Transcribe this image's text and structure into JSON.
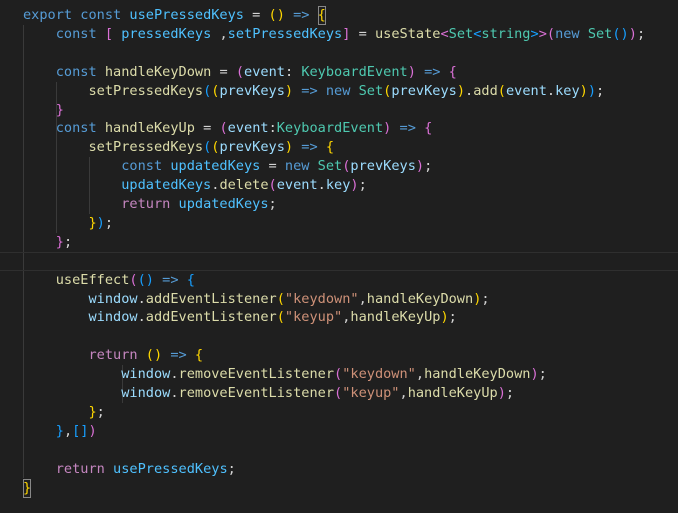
{
  "editor": {
    "language": "typescript",
    "theme_colors": {
      "background": "#1f1f1f",
      "keyword": "#569cd6",
      "control": "#c586c0",
      "constant": "#4fc1ff",
      "identifier": "#9cdcfe",
      "function": "#dcdcaa",
      "type": "#4ec9b0",
      "string": "#ce9178",
      "bracket_1": "#ffd700",
      "bracket_2": "#da70d6",
      "bracket_3": "#179fff"
    },
    "lines": [
      [
        [
          "t-kw",
          "export"
        ],
        [
          "t-op",
          " "
        ],
        [
          "t-kw",
          "const"
        ],
        [
          "t-op",
          " "
        ],
        [
          "t-var",
          "usePressedKeys"
        ],
        [
          "t-op",
          " = "
        ],
        [
          "b1",
          "()"
        ],
        [
          "t-op",
          " "
        ],
        [
          "t-arrow",
          "=>"
        ],
        [
          "t-op",
          " "
        ],
        [
          "b1 bracket-box",
          "{"
        ]
      ],
      [
        [
          "t-op",
          "    "
        ],
        [
          "t-kw",
          "const"
        ],
        [
          "t-op",
          " "
        ],
        [
          "b2",
          "["
        ],
        [
          "t-op",
          " "
        ],
        [
          "t-var",
          "pressedKeys"
        ],
        [
          "t-op",
          " ,"
        ],
        [
          "t-var",
          "setPressedKeys"
        ],
        [
          "b2",
          "]"
        ],
        [
          "t-op",
          " = "
        ],
        [
          "t-fn",
          "useState"
        ],
        [
          "b2",
          "<"
        ],
        [
          "t-type",
          "Set"
        ],
        [
          "b3",
          "<"
        ],
        [
          "t-type",
          "string"
        ],
        [
          "b3",
          ">"
        ],
        [
          "b2",
          ">"
        ],
        [
          "b2",
          "("
        ],
        [
          "t-kw",
          "new"
        ],
        [
          "t-op",
          " "
        ],
        [
          "t-type",
          "Set"
        ],
        [
          "b3",
          "()"
        ],
        [
          "b2",
          ")"
        ],
        [
          "t-op",
          ";"
        ]
      ],
      [],
      [
        [
          "t-op",
          "    "
        ],
        [
          "t-kw",
          "const"
        ],
        [
          "t-op",
          " "
        ],
        [
          "t-fn",
          "handleKeyDown"
        ],
        [
          "t-op",
          " = "
        ],
        [
          "b2",
          "("
        ],
        [
          "t-id",
          "event"
        ],
        [
          "t-op",
          ": "
        ],
        [
          "t-type",
          "KeyboardEvent"
        ],
        [
          "b2",
          ")"
        ],
        [
          "t-op",
          " "
        ],
        [
          "t-arrow",
          "=>"
        ],
        [
          "t-op",
          " "
        ],
        [
          "b2",
          "{"
        ]
      ],
      [
        [
          "t-op",
          "        "
        ],
        [
          "t-fn",
          "setPressedKeys"
        ],
        [
          "b3",
          "("
        ],
        [
          "b1",
          "("
        ],
        [
          "t-id",
          "prevKeys"
        ],
        [
          "b1",
          ")"
        ],
        [
          "t-op",
          " "
        ],
        [
          "t-arrow",
          "=>"
        ],
        [
          "t-op",
          " "
        ],
        [
          "t-kw",
          "new"
        ],
        [
          "t-op",
          " "
        ],
        [
          "t-type",
          "Set"
        ],
        [
          "b1",
          "("
        ],
        [
          "t-id",
          "prevKeys"
        ],
        [
          "b1",
          ")"
        ],
        [
          "t-op",
          "."
        ],
        [
          "t-fn",
          "add"
        ],
        [
          "b1",
          "("
        ],
        [
          "t-id",
          "event"
        ],
        [
          "t-op",
          "."
        ],
        [
          "t-id",
          "key"
        ],
        [
          "b1",
          ")"
        ],
        [
          "b3",
          ")"
        ],
        [
          "t-op",
          ";"
        ]
      ],
      [
        [
          "t-op",
          "    "
        ],
        [
          "b2",
          "}"
        ]
      ],
      [
        [
          "t-op",
          "    "
        ],
        [
          "t-kw",
          "const"
        ],
        [
          "t-op",
          " "
        ],
        [
          "t-fn",
          "handleKeyUp"
        ],
        [
          "t-op",
          " = "
        ],
        [
          "b2",
          "("
        ],
        [
          "t-id",
          "event"
        ],
        [
          "t-op",
          ":"
        ],
        [
          "t-type",
          "KeyboardEvent"
        ],
        [
          "b2",
          ")"
        ],
        [
          "t-op",
          " "
        ],
        [
          "t-arrow",
          "=>"
        ],
        [
          "t-op",
          " "
        ],
        [
          "b2",
          "{"
        ]
      ],
      [
        [
          "t-op",
          "        "
        ],
        [
          "t-fn",
          "setPressedKeys"
        ],
        [
          "b3",
          "("
        ],
        [
          "b1",
          "("
        ],
        [
          "t-id",
          "prevKeys"
        ],
        [
          "b1",
          ")"
        ],
        [
          "t-op",
          " "
        ],
        [
          "t-arrow",
          "=>"
        ],
        [
          "t-op",
          " "
        ],
        [
          "b1",
          "{"
        ]
      ],
      [
        [
          "t-op",
          "            "
        ],
        [
          "t-kw",
          "const"
        ],
        [
          "t-op",
          " "
        ],
        [
          "t-var",
          "updatedKeys"
        ],
        [
          "t-op",
          " = "
        ],
        [
          "t-kw",
          "new"
        ],
        [
          "t-op",
          " "
        ],
        [
          "t-type",
          "Set"
        ],
        [
          "b2",
          "("
        ],
        [
          "t-id",
          "prevKeys"
        ],
        [
          "b2",
          ")"
        ],
        [
          "t-op",
          ";"
        ]
      ],
      [
        [
          "t-op",
          "            "
        ],
        [
          "t-var",
          "updatedKeys"
        ],
        [
          "t-op",
          "."
        ],
        [
          "t-fn",
          "delete"
        ],
        [
          "b2",
          "("
        ],
        [
          "t-id",
          "event"
        ],
        [
          "t-op",
          "."
        ],
        [
          "t-id",
          "key"
        ],
        [
          "b2",
          ")"
        ],
        [
          "t-op",
          ";"
        ]
      ],
      [
        [
          "t-op",
          "            "
        ],
        [
          "t-ctl",
          "return"
        ],
        [
          "t-op",
          " "
        ],
        [
          "t-var",
          "updatedKeys"
        ],
        [
          "t-op",
          ";"
        ]
      ],
      [
        [
          "t-op",
          "        "
        ],
        [
          "b1",
          "}"
        ],
        [
          "b3",
          ")"
        ],
        [
          "t-op",
          ";"
        ]
      ],
      [
        [
          "t-op",
          "    "
        ],
        [
          "b2",
          "}"
        ],
        [
          "t-op",
          ";"
        ]
      ],
      [],
      [
        [
          "t-op",
          "    "
        ],
        [
          "t-fn",
          "useEffect"
        ],
        [
          "b2",
          "("
        ],
        [
          "b3",
          "()"
        ],
        [
          "t-op",
          " "
        ],
        [
          "t-arrow",
          "=>"
        ],
        [
          "t-op",
          " "
        ],
        [
          "b3",
          "{"
        ]
      ],
      [
        [
          "t-op",
          "        "
        ],
        [
          "t-id",
          "window"
        ],
        [
          "t-op",
          "."
        ],
        [
          "t-fn",
          "addEventListener"
        ],
        [
          "b1",
          "("
        ],
        [
          "t-str",
          "\"keydown\""
        ],
        [
          "t-op",
          ","
        ],
        [
          "t-fn",
          "handleKeyDown"
        ],
        [
          "b1",
          ")"
        ],
        [
          "t-op",
          ";"
        ]
      ],
      [
        [
          "t-op",
          "        "
        ],
        [
          "t-id",
          "window"
        ],
        [
          "t-op",
          "."
        ],
        [
          "t-fn",
          "addEventListener"
        ],
        [
          "b1",
          "("
        ],
        [
          "t-str",
          "\"keyup\""
        ],
        [
          "t-op",
          ","
        ],
        [
          "t-fn",
          "handleKeyUp"
        ],
        [
          "b1",
          ")"
        ],
        [
          "t-op",
          ";"
        ]
      ],
      [],
      [
        [
          "t-op",
          "        "
        ],
        [
          "t-ctl",
          "return"
        ],
        [
          "t-op",
          " "
        ],
        [
          "b1",
          "()"
        ],
        [
          "t-op",
          " "
        ],
        [
          "t-arrow",
          "=>"
        ],
        [
          "t-op",
          " "
        ],
        [
          "b1",
          "{"
        ]
      ],
      [
        [
          "t-op",
          "            "
        ],
        [
          "t-id",
          "window"
        ],
        [
          "t-op",
          "."
        ],
        [
          "t-fn",
          "removeEventListener"
        ],
        [
          "b2",
          "("
        ],
        [
          "t-str",
          "\"keydown\""
        ],
        [
          "t-op",
          ","
        ],
        [
          "t-fn",
          "handleKeyDown"
        ],
        [
          "b2",
          ")"
        ],
        [
          "t-op",
          ";"
        ]
      ],
      [
        [
          "t-op",
          "            "
        ],
        [
          "t-id",
          "window"
        ],
        [
          "t-op",
          "."
        ],
        [
          "t-fn",
          "removeEventListener"
        ],
        [
          "b2",
          "("
        ],
        [
          "t-str",
          "\"keyup\""
        ],
        [
          "t-op",
          ","
        ],
        [
          "t-fn",
          "handleKeyUp"
        ],
        [
          "b2",
          ")"
        ],
        [
          "t-op",
          ";"
        ]
      ],
      [
        [
          "t-op",
          "        "
        ],
        [
          "b1",
          "}"
        ],
        [
          "t-op",
          ";"
        ]
      ],
      [
        [
          "t-op",
          "    "
        ],
        [
          "b3",
          "}"
        ],
        [
          "t-op",
          ","
        ],
        [
          "b3",
          "[]"
        ],
        [
          "b2",
          ")"
        ]
      ],
      [],
      [
        [
          "t-op",
          "    "
        ],
        [
          "t-ctl",
          "return"
        ],
        [
          "t-op",
          " "
        ],
        [
          "t-var",
          "usePressedKeys"
        ],
        [
          "t-op",
          ";"
        ]
      ],
      [
        [
          "b1 bracket-box",
          "}"
        ]
      ]
    ]
  }
}
